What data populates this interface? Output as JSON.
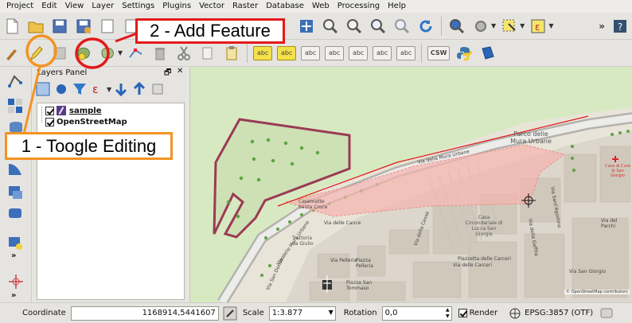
{
  "menubar": [
    "Project",
    "Edit",
    "View",
    "Layer",
    "Settings",
    "Plugins",
    "Vector",
    "Raster",
    "Database",
    "Web",
    "Processing",
    "Help"
  ],
  "layers_panel": {
    "title": "Layers Panel",
    "layers": [
      {
        "name": "sample",
        "checked": true,
        "editing": true
      },
      {
        "name": "OpenStreetMap",
        "checked": true,
        "editing": false
      }
    ]
  },
  "toolbar2_labels": [
    "abc",
    "abc",
    "abc",
    "abc",
    "abc",
    "abc",
    "abc",
    "CSW"
  ],
  "map_labels": {
    "park": "Parco delle Mura Urbane",
    "via_mura": "Via della Mura Urbane",
    "casematte": "Casematte Santa Croce",
    "via_cance": "Via delle Cance",
    "trattoria": "Trattoria da Giulio",
    "via_pelleria": "Via Pelleria",
    "piazza_pelleria": "Piazza Pelleria",
    "piazza_san_tommaso": "Piazza San Tommaso",
    "via_carceri": "Via delle Carceri",
    "piazzetta_carceri": "Piazzetta delle Carceri",
    "casa_circondariale": "Casa Circondariale di Lucca San Giorgio",
    "via_sant_agostino": "Via Sant'Agostino",
    "via_cessa": "Via della Cessa",
    "via_gaffita": "Via della Gaffita",
    "via_san_giorgio": "Via San Giorgio",
    "via_san_donato": "Via San Donato",
    "via_delle_mura": "Via delle Mura Urbane",
    "casa_cura": "Casa di Cura di San Giorgio",
    "via_del_parchi": "Via del Parchi",
    "attribution": "© OpenStreetMap contributors"
  },
  "status": {
    "coordinate_label": "Coordinate",
    "coordinate_value": "1168914,5441607",
    "scale_label": "Scale",
    "scale_value": "1:3.877",
    "rotation_label": "Rotation",
    "rotation_value": "0,0",
    "render_label": "Render",
    "render_checked": true,
    "crs": "EPSG:3857 (OTF)"
  },
  "callouts": {
    "toggle": "1 - Toogle Editing",
    "add": "2 - Add Feature"
  },
  "colors": {
    "callout_orange": "#f39422",
    "callout_red": "#e21a1a",
    "polygon_edge": "#9b3a55",
    "pink_overlay": "#f5b2ae"
  }
}
